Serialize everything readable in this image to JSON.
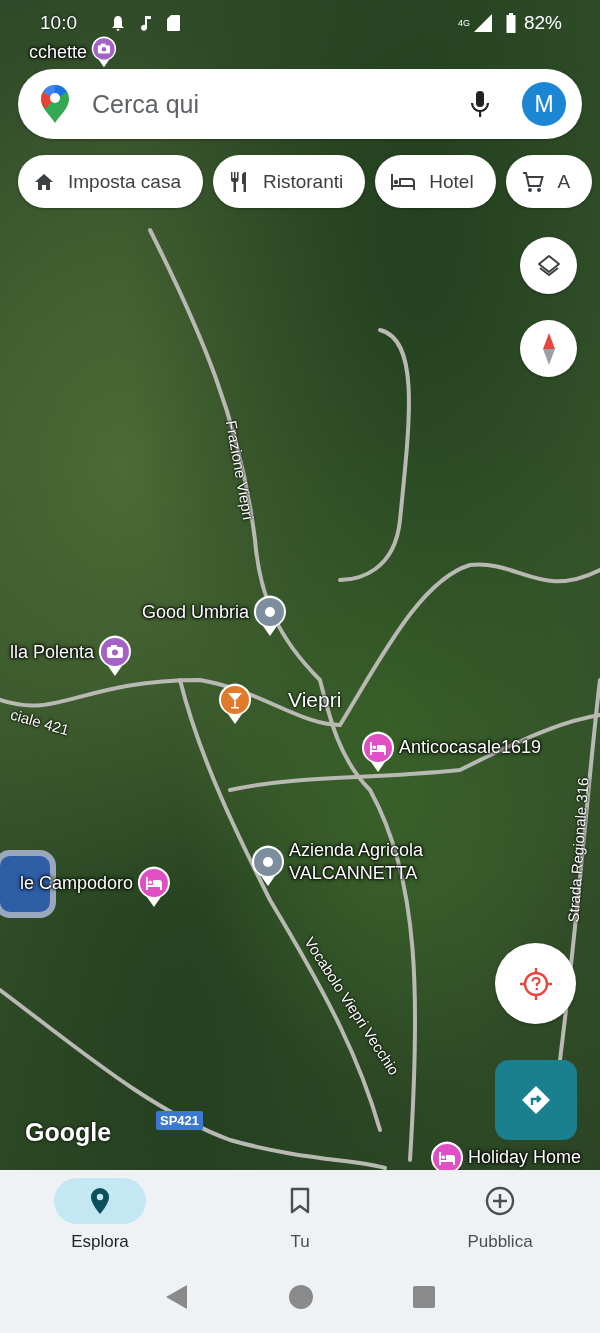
{
  "status_bar": {
    "time": "10:0",
    "network": "4G",
    "battery": "82%"
  },
  "search": {
    "placeholder": "Cerca qui",
    "avatar": "M"
  },
  "chips": [
    {
      "label": "Imposta casa",
      "kind": "home"
    },
    {
      "label": "Ristoranti",
      "kind": "restaurant"
    },
    {
      "label": "Hotel",
      "kind": "hotel"
    },
    {
      "label": "A",
      "kind": "cart"
    }
  ],
  "map_places": [
    {
      "text": "cchette",
      "kind": "photo",
      "color": "#a462c4"
    },
    {
      "text": "Good Umbria",
      "kind": "place",
      "color": "#7d8f9e"
    },
    {
      "text": "lla Polenta",
      "kind": "photo",
      "color": "#a462c4"
    },
    {
      "kind": "bar",
      "color": "#e07b2e"
    },
    {
      "text": "Viepri",
      "kind": "town"
    },
    {
      "text": "Anticocasale1619",
      "kind": "hotel",
      "color": "#e04fc4"
    },
    {
      "text": "Azienda Agricola VALCANNETTA",
      "kind": "place",
      "color": "#7d8f9e"
    },
    {
      "text": "le Campodoro",
      "kind": "hotel",
      "color": "#e04fc4"
    },
    {
      "text": "Holiday Home",
      "kind": "hotel",
      "color": "#e04fc4"
    }
  ],
  "road_labels": [
    {
      "text": "Frazione Viepri"
    },
    {
      "text": "ciale 421"
    },
    {
      "text": "Vocabolo Viepri Vecchio"
    },
    {
      "text": "Strada Regionale 316"
    }
  ],
  "road_shield": "SP421",
  "map_logo": "Google",
  "nav_tabs": [
    {
      "label": "Esplora",
      "kind": "explore",
      "selected": true
    },
    {
      "label": "Tu",
      "kind": "saved",
      "selected": false
    },
    {
      "label": "Pubblica",
      "kind": "contribute",
      "selected": false
    }
  ]
}
